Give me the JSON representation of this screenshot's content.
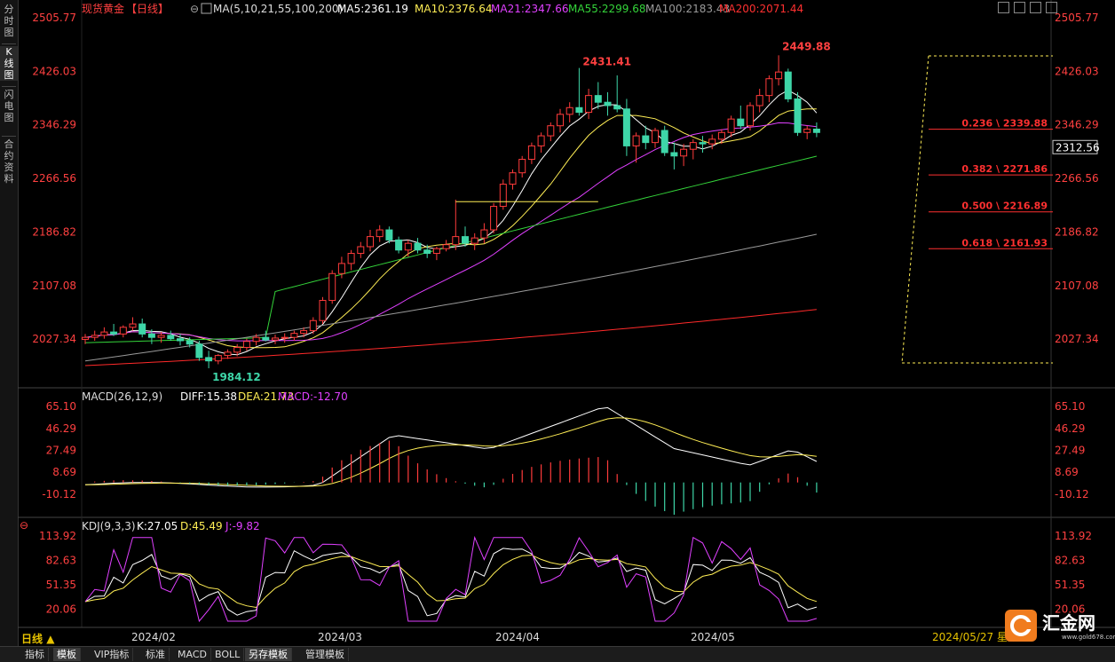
{
  "sidebar": {
    "items": [
      {
        "label": "分时图",
        "active": false
      },
      {
        "label": "K线图",
        "active": true
      },
      {
        "label": "闪电图",
        "active": false
      },
      {
        "label": "合约资料",
        "active": false
      }
    ]
  },
  "header": {
    "symbol": "现货黄金",
    "period_tag": "【日线】",
    "ma_title": "MA(5,10,21,55,100,200)",
    "ma5": "MA5:2361.19",
    "ma10": "MA10:2376.64",
    "ma21": "MA21:2347.66",
    "ma55": "MA55:2299.68",
    "ma100": "MA100:2183.43",
    "ma200": "MA200:2071.44"
  },
  "colors": {
    "up": "#ff3b3b",
    "down": "#3ed6a8",
    "ma5": "#ffffff",
    "ma10": "#ffee55",
    "ma21": "#e040ff",
    "ma55": "#34d43a",
    "ma100": "#9a9a9a",
    "ma200": "#ff2a2a",
    "fib": "#ff3030",
    "axis_text": "#ff4040"
  },
  "price_axis": [
    "2505.77",
    "2426.03",
    "2346.29",
    "2266.56",
    "2186.82",
    "2107.08",
    "2027.34"
  ],
  "current_price": "2312.56",
  "annotations": {
    "high1": "2431.41",
    "high2": "2449.88",
    "low": "1984.12"
  },
  "fib_levels": [
    {
      "label": "0.236 \\ 2339.88",
      "value": 2339.88
    },
    {
      "label": "0.382 \\ 2271.86",
      "value": 2271.86
    },
    {
      "label": "0.500 \\ 2216.89",
      "value": 2216.89
    },
    {
      "label": "0.618 \\ 2161.93",
      "value": 2161.93
    }
  ],
  "macd": {
    "title": "MACD(26,12,9)",
    "diff": "DIFF:15.38",
    "dea": "DEA:21.73",
    "macd": "MACD:-12.70",
    "axis": [
      "65.10",
      "46.29",
      "27.49",
      "8.69",
      "-10.12"
    ]
  },
  "kdj": {
    "title": "KDJ(9,3,3)",
    "k": "K:27.05",
    "d": "D:45.49",
    "j": "J:-9.82",
    "axis": [
      "113.92",
      "82.63",
      "51.35",
      "20.06"
    ]
  },
  "dates": [
    "2024/02",
    "2024/03",
    "2024/04",
    "2024/05"
  ],
  "status_date": "2024/05/27 星期",
  "period_button": "日线",
  "bottom_tabs": [
    {
      "label": "指标",
      "selected": false
    },
    {
      "label": "模板",
      "selected": true
    },
    {
      "label": "VIP指标",
      "selected": false
    },
    {
      "label": "标准",
      "selected": false
    },
    {
      "label": "MACD",
      "selected": false
    },
    {
      "label": "BOLL",
      "selected": false
    },
    {
      "label": "另存模板",
      "selected": true
    },
    {
      "label": "管理模板",
      "selected": false
    }
  ],
  "logo": {
    "name": "汇金网",
    "url_text": "www.gold678.com"
  },
  "chart_data": {
    "type": "candlestick",
    "note_values": "approximate daily OHLC read from the chart",
    "ylim": [
      1984,
      2505.77
    ],
    "series_ohlc": [
      [
        2027,
        2035,
        2020,
        2030
      ],
      [
        2030,
        2040,
        2025,
        2033
      ],
      [
        2033,
        2045,
        2028,
        2038
      ],
      [
        2038,
        2050,
        2032,
        2035
      ],
      [
        2035,
        2048,
        2030,
        2045
      ],
      [
        2045,
        2060,
        2040,
        2050
      ],
      [
        2050,
        2058,
        2030,
        2035
      ],
      [
        2035,
        2042,
        2020,
        2030
      ],
      [
        2030,
        2038,
        2022,
        2033
      ],
      [
        2033,
        2040,
        2025,
        2028
      ],
      [
        2028,
        2035,
        2018,
        2025
      ],
      [
        2025,
        2030,
        2015,
        2020
      ],
      [
        2020,
        2025,
        1995,
        2000
      ],
      [
        2000,
        2010,
        1984,
        1995
      ],
      [
        1995,
        2005,
        1990,
        2003
      ],
      [
        2003,
        2012,
        1998,
        2008
      ],
      [
        2008,
        2020,
        2002,
        2015
      ],
      [
        2015,
        2028,
        2010,
        2024
      ],
      [
        2024,
        2035,
        2018,
        2030
      ],
      [
        2030,
        2040,
        2024,
        2026
      ],
      [
        2026,
        2034,
        2020,
        2029
      ],
      [
        2029,
        2036,
        2022,
        2030
      ],
      [
        2030,
        2040,
        2025,
        2036
      ],
      [
        2036,
        2045,
        2030,
        2040
      ],
      [
        2040,
        2060,
        2035,
        2055
      ],
      [
        2055,
        2090,
        2050,
        2085
      ],
      [
        2085,
        2130,
        2080,
        2125
      ],
      [
        2125,
        2150,
        2118,
        2140
      ],
      [
        2140,
        2160,
        2130,
        2155
      ],
      [
        2155,
        2172,
        2148,
        2165
      ],
      [
        2165,
        2190,
        2158,
        2180
      ],
      [
        2180,
        2197,
        2172,
        2190
      ],
      [
        2190,
        2195,
        2170,
        2175
      ],
      [
        2175,
        2180,
        2155,
        2160
      ],
      [
        2160,
        2175,
        2150,
        2170
      ],
      [
        2170,
        2178,
        2155,
        2160
      ],
      [
        2160,
        2168,
        2148,
        2155
      ],
      [
        2155,
        2165,
        2145,
        2162
      ],
      [
        2162,
        2175,
        2158,
        2168
      ],
      [
        2168,
        2235,
        2160,
        2180
      ],
      [
        2180,
        2195,
        2165,
        2170
      ],
      [
        2170,
        2185,
        2160,
        2178
      ],
      [
        2178,
        2200,
        2170,
        2190
      ],
      [
        2190,
        2230,
        2185,
        2225
      ],
      [
        2225,
        2265,
        2220,
        2258
      ],
      [
        2258,
        2280,
        2250,
        2275
      ],
      [
        2275,
        2300,
        2268,
        2295
      ],
      [
        2295,
        2320,
        2288,
        2315
      ],
      [
        2315,
        2335,
        2305,
        2330
      ],
      [
        2330,
        2350,
        2322,
        2345
      ],
      [
        2345,
        2370,
        2335,
        2362
      ],
      [
        2362,
        2380,
        2350,
        2372
      ],
      [
        2372,
        2431,
        2360,
        2365
      ],
      [
        2365,
        2400,
        2355,
        2390
      ],
      [
        2390,
        2410,
        2370,
        2380
      ],
      [
        2380,
        2395,
        2360,
        2375
      ],
      [
        2375,
        2420,
        2365,
        2370
      ],
      [
        2370,
        2385,
        2300,
        2315
      ],
      [
        2315,
        2335,
        2290,
        2330
      ],
      [
        2330,
        2345,
        2310,
        2320
      ],
      [
        2320,
        2342,
        2312,
        2338
      ],
      [
        2338,
        2345,
        2300,
        2305
      ],
      [
        2305,
        2320,
        2280,
        2300
      ],
      [
        2300,
        2318,
        2285,
        2310
      ],
      [
        2310,
        2325,
        2295,
        2320
      ],
      [
        2320,
        2330,
        2305,
        2318
      ],
      [
        2318,
        2332,
        2310,
        2325
      ],
      [
        2325,
        2340,
        2318,
        2335
      ],
      [
        2335,
        2360,
        2328,
        2355
      ],
      [
        2355,
        2375,
        2340,
        2345
      ],
      [
        2345,
        2380,
        2338,
        2375
      ],
      [
        2375,
        2400,
        2365,
        2390
      ],
      [
        2390,
        2420,
        2380,
        2415
      ],
      [
        2415,
        2449.88,
        2405,
        2425
      ],
      [
        2425,
        2430,
        2380,
        2385
      ],
      [
        2385,
        2395,
        2330,
        2335
      ],
      [
        2335,
        2345,
        2325,
        2340
      ],
      [
        2340,
        2350,
        2328,
        2335
      ]
    ]
  }
}
